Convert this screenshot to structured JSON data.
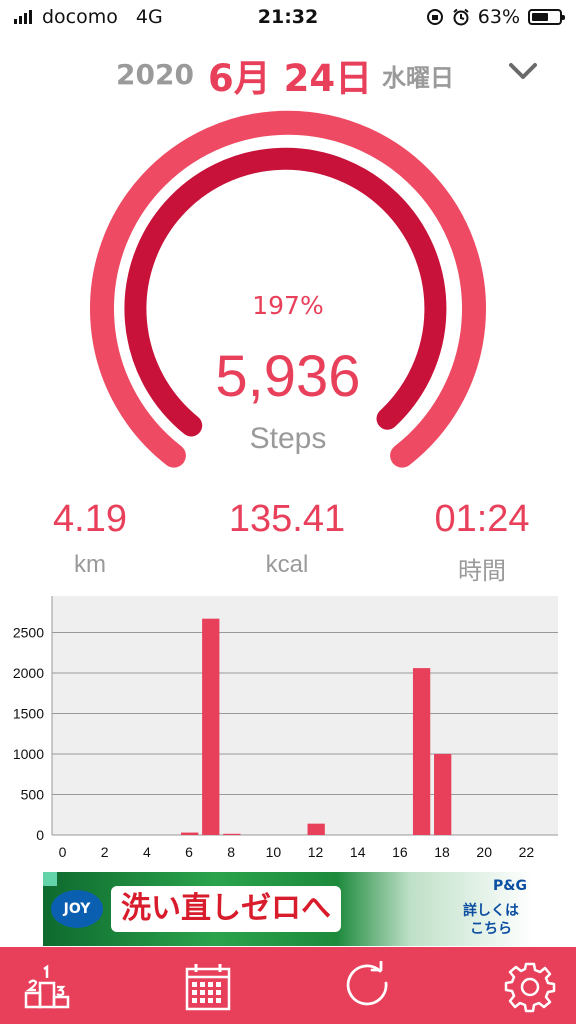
{
  "status_bar": {
    "carrier": "docomo",
    "network": "4G",
    "time": "21:32",
    "battery": "63%",
    "battery_level": 0.63
  },
  "date_header": {
    "year": "2020",
    "month_day": "6月 24日",
    "weekday": "水曜日",
    "dropdown_icon": "chevron-down-icon"
  },
  "progress": {
    "percent_label": "197%",
    "steps": "5,936",
    "unit": "Steps",
    "accent_color": "#e8405a",
    "inner_color": "#c8123a"
  },
  "stats": {
    "distance": {
      "value": "4.19",
      "unit": "km"
    },
    "calories": {
      "value": "135.41",
      "unit": "kcal"
    },
    "duration": {
      "value": "01:24",
      "unit": "時間"
    }
  },
  "chart_data": {
    "type": "bar",
    "x": [
      0,
      1,
      2,
      3,
      4,
      5,
      6,
      7,
      8,
      9,
      10,
      11,
      12,
      13,
      14,
      15,
      16,
      17,
      18,
      19,
      20,
      21,
      22,
      23
    ],
    "values": [
      0,
      0,
      0,
      0,
      0,
      0,
      30,
      2670,
      15,
      0,
      0,
      0,
      140,
      0,
      0,
      0,
      0,
      2060,
      1000,
      0,
      0,
      0,
      0,
      0
    ],
    "x_tick_labels": [
      "0",
      "2",
      "4",
      "6",
      "8",
      "10",
      "12",
      "14",
      "16",
      "18",
      "20",
      "22"
    ],
    "y_tick_labels": [
      "0",
      "500",
      "1000",
      "1500",
      "2000",
      "2500"
    ],
    "ylim": [
      0,
      2950
    ],
    "grid": true,
    "bar_color": "#e8405a",
    "title": "",
    "xlabel": "",
    "ylabel": ""
  },
  "ad": {
    "brand": "JOY",
    "headline": "洗い直しゼロへ",
    "company": "P&G",
    "cta": "詳しくは こちら"
  },
  "tab_bar": {
    "tabs": [
      {
        "icon": "ranking-podium-icon"
      },
      {
        "icon": "calendar-icon"
      },
      {
        "icon": "refresh-icon"
      },
      {
        "icon": "gear-icon"
      }
    ]
  }
}
